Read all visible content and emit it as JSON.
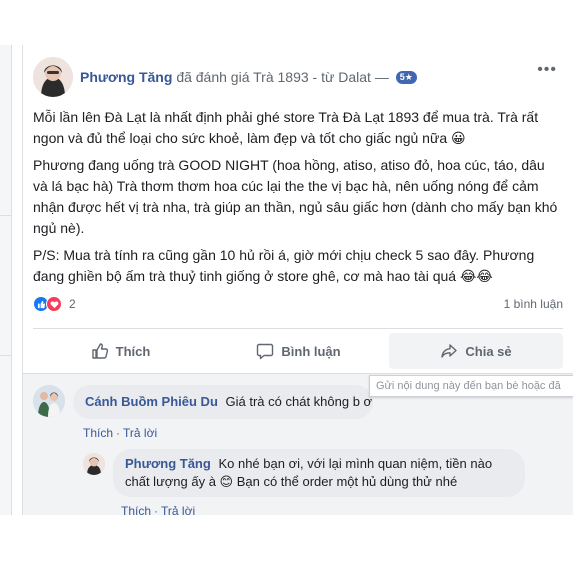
{
  "post": {
    "author": "Phương Tăng",
    "action_text": "đã đánh giá",
    "page_name": "Trà 1893 - từ Dalat",
    "separator": "—",
    "rating": "5★",
    "more_icon": "more-horizontal-icon",
    "paragraphs": [
      "Mỗi lần lên Đà Lạt là nhất định phải ghé store Trà Đà Lạt 1893 để mua trà. Trà rất ngon và đủ thể loại cho sức khoẻ, làm đẹp và tốt cho giấc ngủ nữa 😀",
      "Phương đang uống trà GOOD NIGHT (hoa hồng, atiso, atiso đỏ, hoa cúc, táo, dâu và lá bạc hà) Trà thơm thơm hoa cúc lại the the vị bạc hà, nên uống nóng để cảm nhận được hết vị trà nha, trà giúp an thần, ngủ sâu giấc hơn (dành cho mấy bạn khó ngủ nè).",
      "P/S: Mua trà tính ra cũng gần 10 hủ rồi á, giờ mới chịu check 5 sao đây. Phương đang ghiền bộ ấm trà thuỷ tinh giống ở store ghê, cơ mà hao tài quá 😂😂"
    ],
    "reaction_count": "2",
    "comment_count": "1 bình luận",
    "reaction_icons": [
      "like-icon",
      "love-icon"
    ]
  },
  "actions": {
    "like": "Thích",
    "comment": "Bình luận",
    "share": "Chia sẻ"
  },
  "tooltip": "Gửi nội dung này đến bạn bè hoặc đă",
  "comments": [
    {
      "author": "Cánh Buồm Phiêu Du",
      "text": "Giá trà có chát không b ơi",
      "like": "Thích",
      "reply": "Trả lời"
    },
    {
      "author": "Phương Tăng",
      "text": "Ko nhé bạn ơi, với lại mình quan niệm, tiền nào chất lượng ấy à 😊 Bạn có thể order một hủ dùng thử nhé",
      "like": "Thích",
      "reply": "Trả lời"
    }
  ],
  "colors": {
    "link": "#385898",
    "muted": "#606770",
    "badge": "#4267b2",
    "like": "#1877f2",
    "love": "#f33e58"
  }
}
